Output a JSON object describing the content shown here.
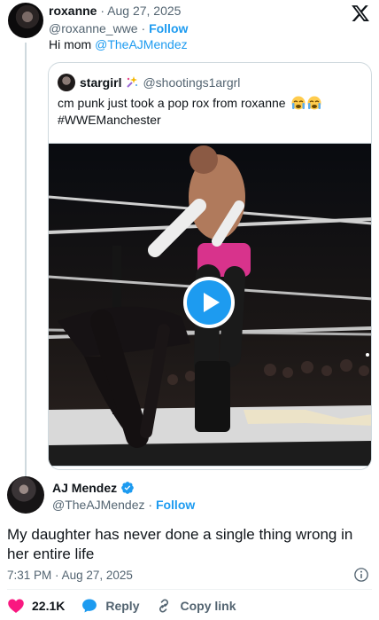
{
  "parent_tweet": {
    "author_name": "roxanne",
    "date": "Aug 27, 2025",
    "handle": "@roxanne_wwe",
    "follow_label": "Follow",
    "text_prefix": "Hi mom",
    "mention": "@TheAJMendez"
  },
  "quoted_tweet": {
    "author_name": "stargirl",
    "handle": "@shootings1argrl",
    "text_line1": "cm punk just took a pop rox from roxanne",
    "text_line2": "#WWEManchester",
    "media_type": "video"
  },
  "main_tweet": {
    "author_name": "AJ Mendez",
    "handle": "@TheAJMendez",
    "follow_label": "Follow",
    "text": "My daughter has never done a single thing wrong in her entire life",
    "time": "7:31 PM",
    "date": "Aug 27, 2025"
  },
  "actions": {
    "likes": "22.1K",
    "reply_label": "Reply",
    "copy_label": "Copy link"
  },
  "colors": {
    "accent": "#1d9bf0",
    "like": "#f91880",
    "muted": "#536471",
    "border": "#cfd9de"
  },
  "icons": [
    "x-logo-icon",
    "verified-badge-icon",
    "info-icon",
    "heart-icon",
    "reply-icon",
    "link-icon",
    "play-icon"
  ]
}
